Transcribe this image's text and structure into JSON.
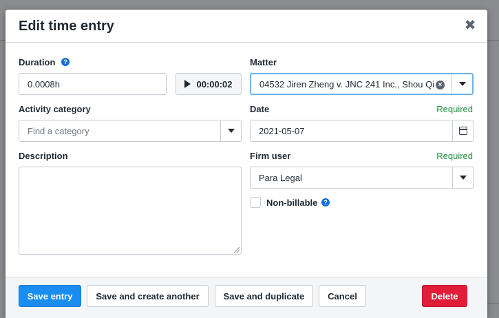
{
  "modal": {
    "title": "Edit time entry",
    "close_glyph": "✖"
  },
  "fields": {
    "duration": {
      "label": "Duration",
      "value": "0.0008h",
      "help_glyph": "?"
    },
    "timer": {
      "value": "00:00:02"
    },
    "matter": {
      "label": "Matter",
      "value": "04532 Jiren Zheng v. JNC 241 Inc., Shou Qi"
    },
    "activity_category": {
      "label": "Activity category",
      "placeholder": "Find a category"
    },
    "date": {
      "label": "Date",
      "required": "Required",
      "value": "2021-05-07"
    },
    "description": {
      "label": "Description",
      "value": ""
    },
    "firm_user": {
      "label": "Firm user",
      "required": "Required",
      "value": "Para Legal"
    },
    "non_billable": {
      "label": "Non-billable",
      "checked": false,
      "help_glyph": "?"
    }
  },
  "footer": {
    "save_entry": "Save entry",
    "save_and_create": "Save and create another",
    "save_and_duplicate": "Save and duplicate",
    "cancel": "Cancel",
    "delete": "Delete"
  },
  "colors": {
    "primary": "#1a8ef0",
    "danger": "#e11d37",
    "required": "#1e8f3d",
    "help": "#1570d6",
    "focus": "#6fb2ea"
  },
  "icons": {
    "close": "close-icon",
    "help": "help-circle-icon",
    "play": "play-icon",
    "dropdown": "chevron-down-icon",
    "clear": "clear-circle-icon",
    "calendar": "calendar-icon"
  }
}
